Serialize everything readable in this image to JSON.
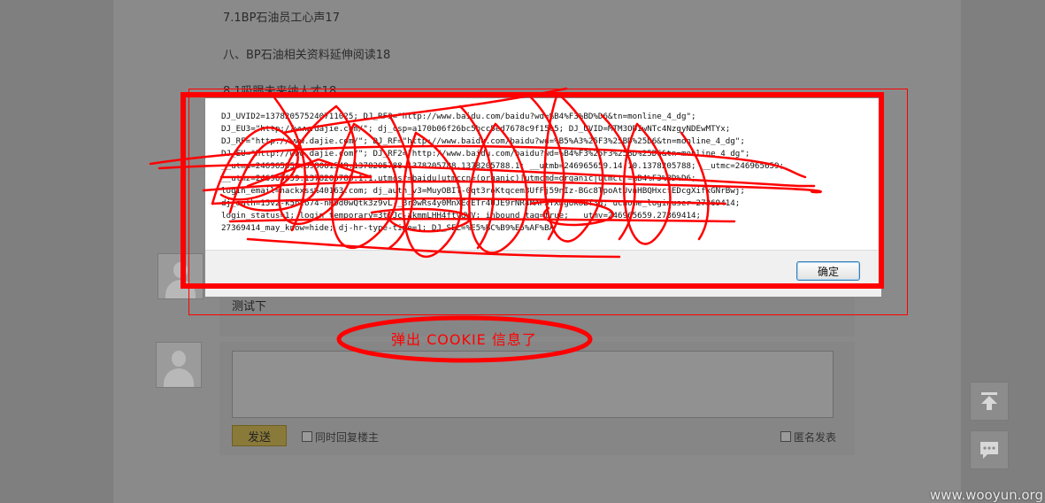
{
  "article": {
    "toc_items": [
      "7.1BP石油员工心声17",
      "八、BP石油相关资料延伸阅读18",
      "8.1吸眼未来纳人才18"
    ]
  },
  "comment": {
    "text": "测试下"
  },
  "reply": {
    "send_label": "发送",
    "reply_owner_label": "同时回复楼主",
    "anonymous_label": "匿名发表"
  },
  "alert": {
    "message": "DJ_UVID2=137820575240711025; DJ_RF3=\"http://www.baidu.com/baidu?wd=%B4%F3%BD%D6&tn=monline_4_dg\";\nDJ_EU3=\"http://www.dajie.com/\"; dj_csp=a170b06f26bc5bcc5ed7678c9f15c5; DJ_UVID=MTM3ODIwNTc4NzgyNDEwMTYx;\nDJ_RF=\"http://www.dajie.com/\"; DJ_RF=\"http://www.baidu.com/baidu?wd=%B5%A3%25F3%25BD%25D6&tn=monline_4_dg\";\nDJ_EU=\"http://www.dajie.com/\"; DJ_RF2=\"http://www.baidu.com/baidu?wd=%B4%F3%25F3%25BD%25D6&tn=monline_4_dg\";\n__utma=246965659.898061549.1378205788.1378205788.1378205788.1; __utmb=246965659.14.10.1378205788; __utmc=246965659;\n__utmz=246965659.1378205788.1.1.utmcsr=baidu|utmccn=(organic)|utmcmd=organic|utmctr=%B4%F3%BD%D6;\nlogin_email=hackxss%40163.com; dj_auth_v3=MuyOBIT-0qt3roKtqcem3UfFj59nIz-BGc8TpoAtUvnHBQHxcfEDcgXifxGNrBwj;\ndj_auth=15v2-k5nto74-nRDd0wQtk3z9vL-_Br0wRs4y0MnXEqETr4UJE9rNR4MAF3YXhgUk8Bf3g; uchome_loginuser=27369414;\nlogin_status=1; login_temporary=3tPJc-akmmLHH4ftydWV; inbound_tag=true; __utmv=246965659.27369414;\n27369414_may_know=hide; dj-hr-type-time=1; DJ_SEL=%E5%BC%B9%E5%AF%BA",
    "ok_label": "确定"
  },
  "annotation": {
    "text": "弹出 COOKIE 信息了",
    "color": "#ff0000"
  },
  "watermark": "www.wooyun.org",
  "icons": {
    "back_to_top": "arrow-up-icon",
    "feedback": "chat-bubble-icon"
  }
}
